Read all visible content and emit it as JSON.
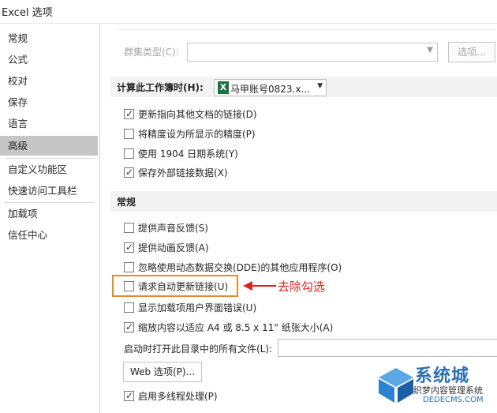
{
  "window": {
    "title": "Excel 选项"
  },
  "nav": {
    "items": [
      {
        "label": "常规"
      },
      {
        "label": "公式"
      },
      {
        "label": "校对"
      },
      {
        "label": "保存"
      },
      {
        "label": "语言"
      },
      {
        "label": "高级",
        "selected": true
      },
      {
        "label": "自定义功能区"
      },
      {
        "label": "快速访问工具栏"
      },
      {
        "label": "加载项"
      },
      {
        "label": "信任中心"
      }
    ]
  },
  "cluster": {
    "label": "群集类型(C):",
    "options_button": "选项..."
  },
  "workbook_section": {
    "label": "计算此工作簿时(H):",
    "workbook_name": "马甲账号0823.x...",
    "icon": "excel-icon",
    "options": [
      {
        "label": "更新指向其他文档的链接(D)",
        "checked": true
      },
      {
        "label": "将精度设为所显示的精度(P)",
        "checked": false
      },
      {
        "label": "使用 1904 日期系统(Y)",
        "checked": false
      },
      {
        "label": "保存外部链接数据(X)",
        "checked": true
      }
    ]
  },
  "general_section": {
    "heading": "常规",
    "options": [
      {
        "label": "提供声音反馈(S)",
        "checked": false
      },
      {
        "label": "提供动画反馈(A)",
        "checked": true
      },
      {
        "label": "忽略使用动态数据交换(DDE)的其他应用程序(O)",
        "checked": false
      },
      {
        "label": "请求自动更新链接(U)",
        "checked": false
      },
      {
        "label": "显示加载项用户界面错误(U)",
        "checked": false
      },
      {
        "label": "缩放内容以适应 A4 或 8.5 x 11\" 纸张大小(A)",
        "checked": true
      }
    ],
    "startup_files_label": "启动时打开此目录中的所有文件(L):",
    "startup_files_value": "",
    "web_options_button": "Web 选项(P)...",
    "multithread": {
      "label": "启用多线程处理(P)",
      "checked": true
    }
  },
  "annotation": {
    "text": "去除勾选",
    "color": "#d9261c",
    "highlight_color": "#e58a2e"
  },
  "watermark": {
    "brand": "系统城",
    "line1": "织梦内容管理系统",
    "line2": "DEDECMS.COM"
  }
}
